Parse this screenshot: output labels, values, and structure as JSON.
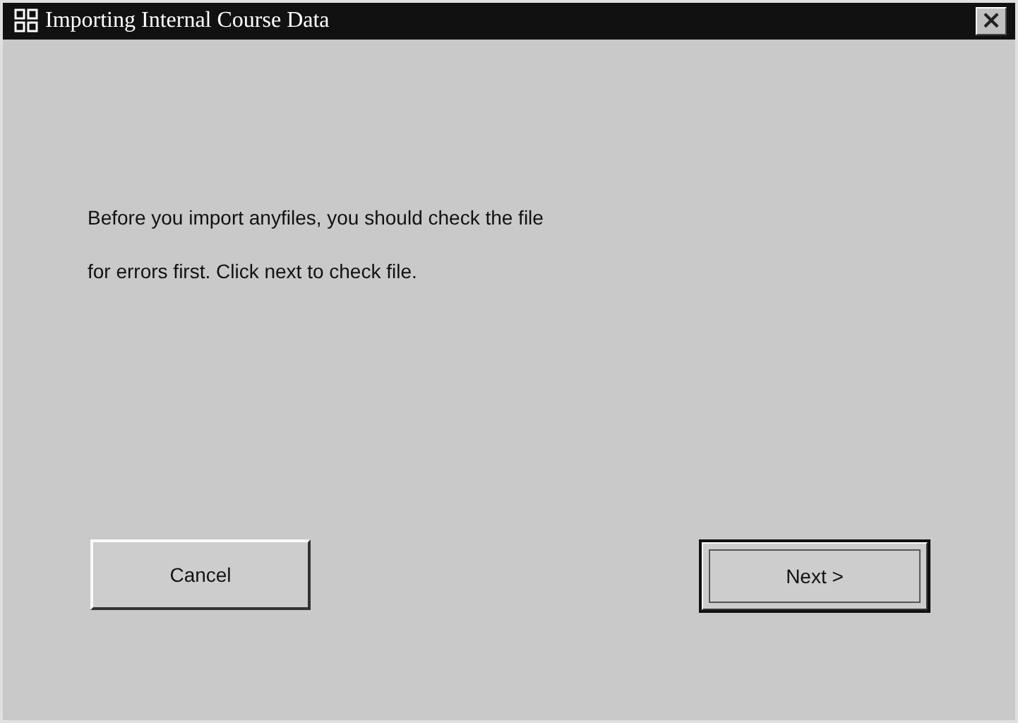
{
  "window": {
    "title": "Importing Internal Course Data",
    "close": "×"
  },
  "message": [
    "Before you import anyfiles, you should check the file",
    "for errors first. Click next to check file."
  ],
  "buttons": [
    {
      "label": "Cancel",
      "default": false
    },
    {
      "label": "Next >",
      "default": true
    }
  ]
}
